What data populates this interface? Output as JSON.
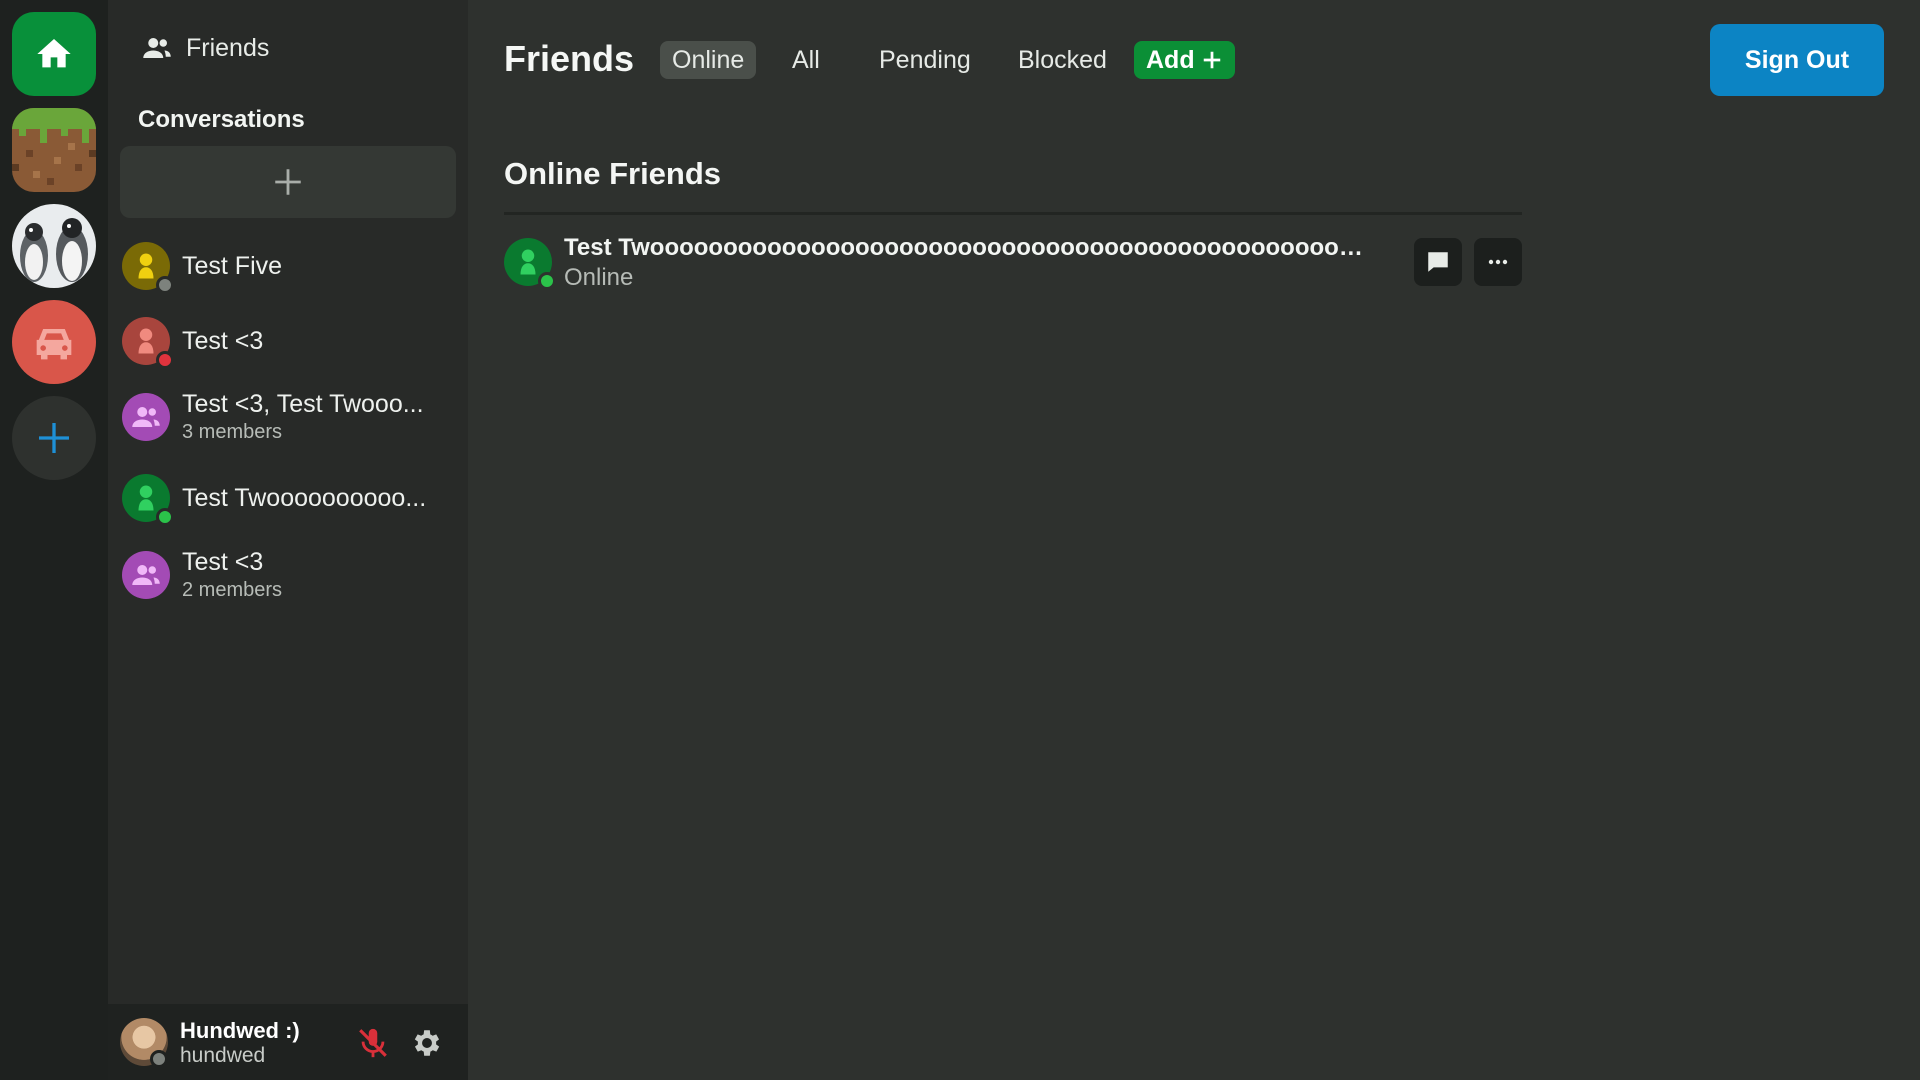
{
  "rail": {
    "servers": [
      {
        "name": "home",
        "icon": "home-icon"
      },
      {
        "name": "grass-block-server",
        "icon": "grass-block-image"
      },
      {
        "name": "penguins-server",
        "icon": "penguins-image"
      },
      {
        "name": "car-server",
        "icon": "car-icon"
      }
    ],
    "add_server_icon": "plus-icon"
  },
  "sidebar": {
    "friends_label": "Friends",
    "conversations_title": "Conversations",
    "conversations": [
      {
        "name": "Test Five",
        "sub": "",
        "avatar_color": "#b59a08",
        "status": "offline"
      },
      {
        "name": "Test <3",
        "sub": "",
        "avatar_color": "#d9564a",
        "status": "dnd"
      },
      {
        "name": "Test <3, Test Twooo...",
        "sub": "3 members",
        "avatar_color": "#b455c9",
        "status": "group"
      },
      {
        "name": "Test Twoooooooooo...",
        "sub": "",
        "avatar_color": "#0b8f36",
        "status": "online"
      },
      {
        "name": "Test <3",
        "sub": "2 members",
        "avatar_color": "#b455c9",
        "status": "group"
      }
    ]
  },
  "user": {
    "display_name": "Hundwed :)",
    "handle": "hundwed",
    "mic_muted": true
  },
  "main": {
    "title": "Friends",
    "tabs": {
      "online": "Online",
      "all": "All",
      "pending": "Pending",
      "blocked": "Blocked",
      "add": "Add"
    },
    "active_tab": "Online",
    "sign_out": "Sign Out",
    "section_title": "Online Friends",
    "friends": [
      {
        "name": "Test Twoooooooooooooooooooooooooooooooooooooooooooooooooo...",
        "status": "Online"
      }
    ]
  },
  "colors": {
    "accent_green": "#0b8f36",
    "accent_blue": "#0c84c4",
    "online": "#2bc24a",
    "dnd": "#e0333d",
    "offline": "#7d827d"
  }
}
